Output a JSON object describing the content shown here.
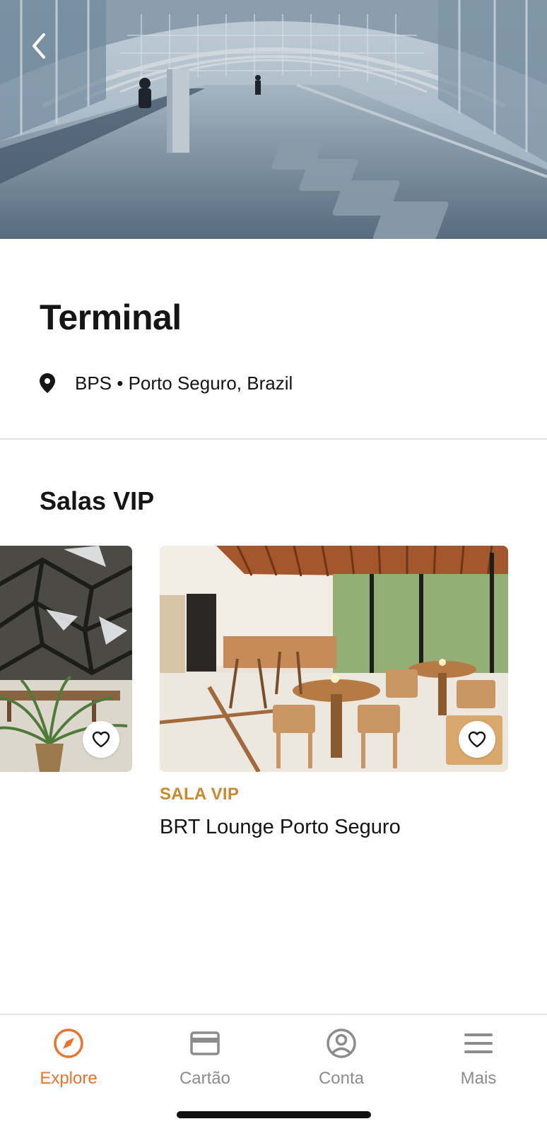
{
  "header": {
    "title": "Terminal",
    "location": "BPS • Porto Seguro, Brazil"
  },
  "section": {
    "title": "Salas VIP"
  },
  "cards": [
    {
      "category": "",
      "name": ""
    },
    {
      "category": "SALA VIP",
      "name": "BRT Lounge Porto Seguro"
    }
  ],
  "nav": {
    "items": [
      {
        "label": "Explore",
        "icon": "compass-icon",
        "active": true
      },
      {
        "label": "Cartão",
        "icon": "card-icon",
        "active": false
      },
      {
        "label": "Conta",
        "icon": "account-icon",
        "active": false
      },
      {
        "label": "Mais",
        "icon": "menu-icon",
        "active": false
      }
    ]
  },
  "colors": {
    "accent": "#e8742e",
    "category": "#c98a2e",
    "inactive": "#8c8c8c"
  }
}
